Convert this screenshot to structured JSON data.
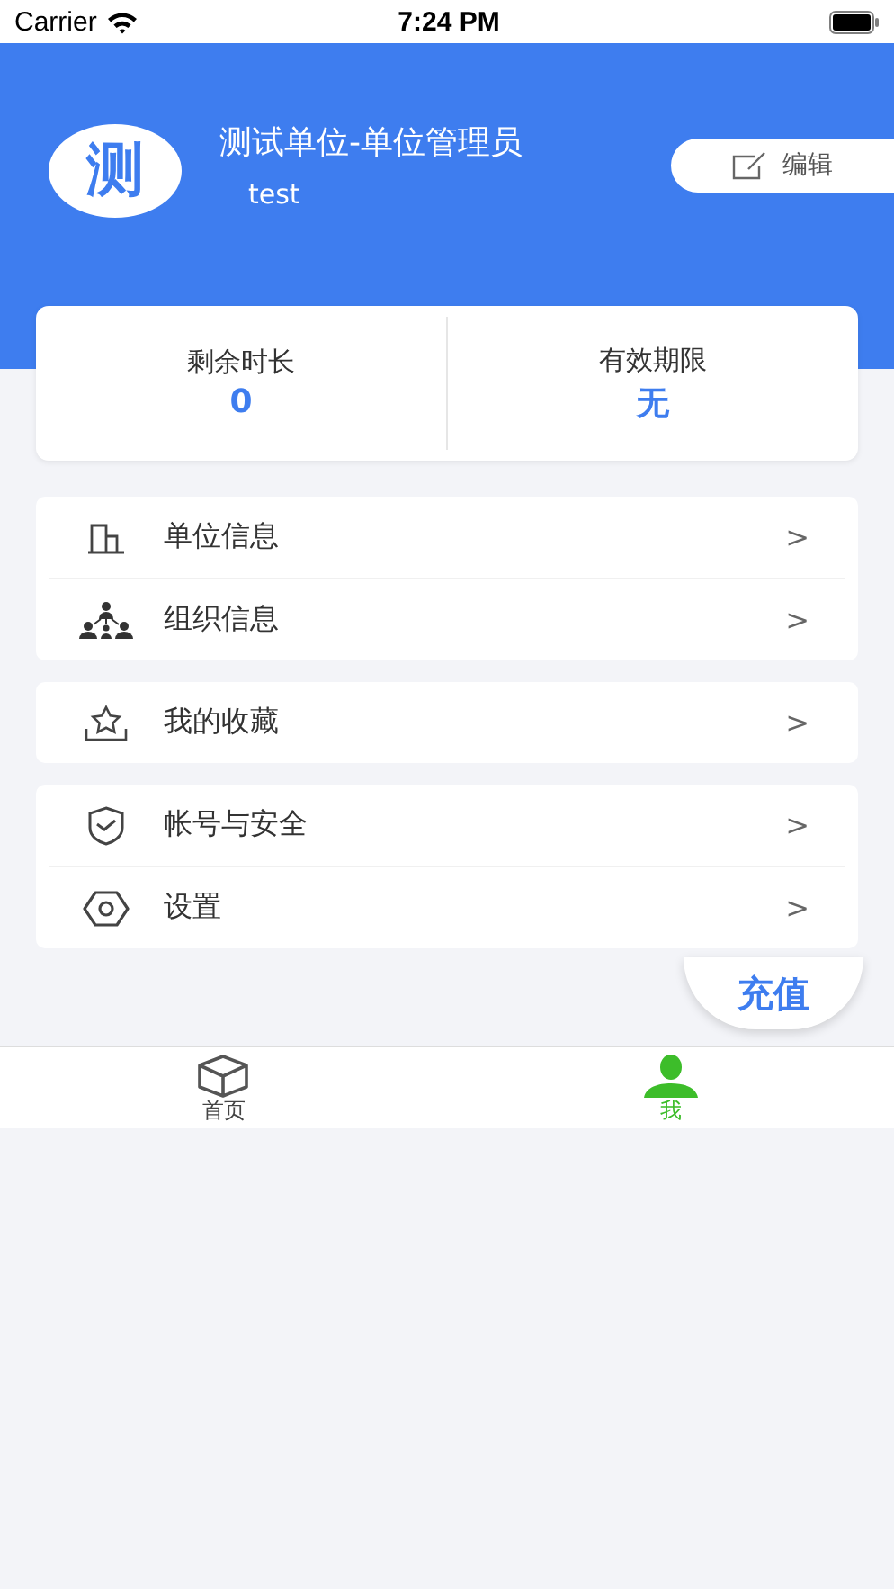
{
  "status_bar": {
    "carrier": "Carrier",
    "time": "7:24 PM"
  },
  "profile": {
    "avatar_char": "测",
    "name": "测试单位-单位管理员",
    "account": "test",
    "edit_button": "编辑"
  },
  "stats": [
    {
      "label": "剩余时长",
      "value": "0"
    },
    {
      "label": "有效期限",
      "value": "无"
    }
  ],
  "menu_groups": [
    [
      {
        "label": "单位信息",
        "kind": "building",
        "chevron": ">"
      },
      {
        "label": "组织信息",
        "kind": "org",
        "chevron": ">"
      }
    ],
    [
      {
        "label": "我的收藏",
        "kind": "star",
        "chevron": ">"
      }
    ],
    [
      {
        "label": "帐号与安全",
        "kind": "shield",
        "chevron": ">"
      },
      {
        "label": "设置",
        "kind": "gear",
        "chevron": ">"
      }
    ]
  ],
  "recharge_button": "充值",
  "tabs": [
    {
      "label": "首页",
      "kind": "cube",
      "selected": false
    },
    {
      "label": "我",
      "kind": "person",
      "selected": true
    }
  ]
}
